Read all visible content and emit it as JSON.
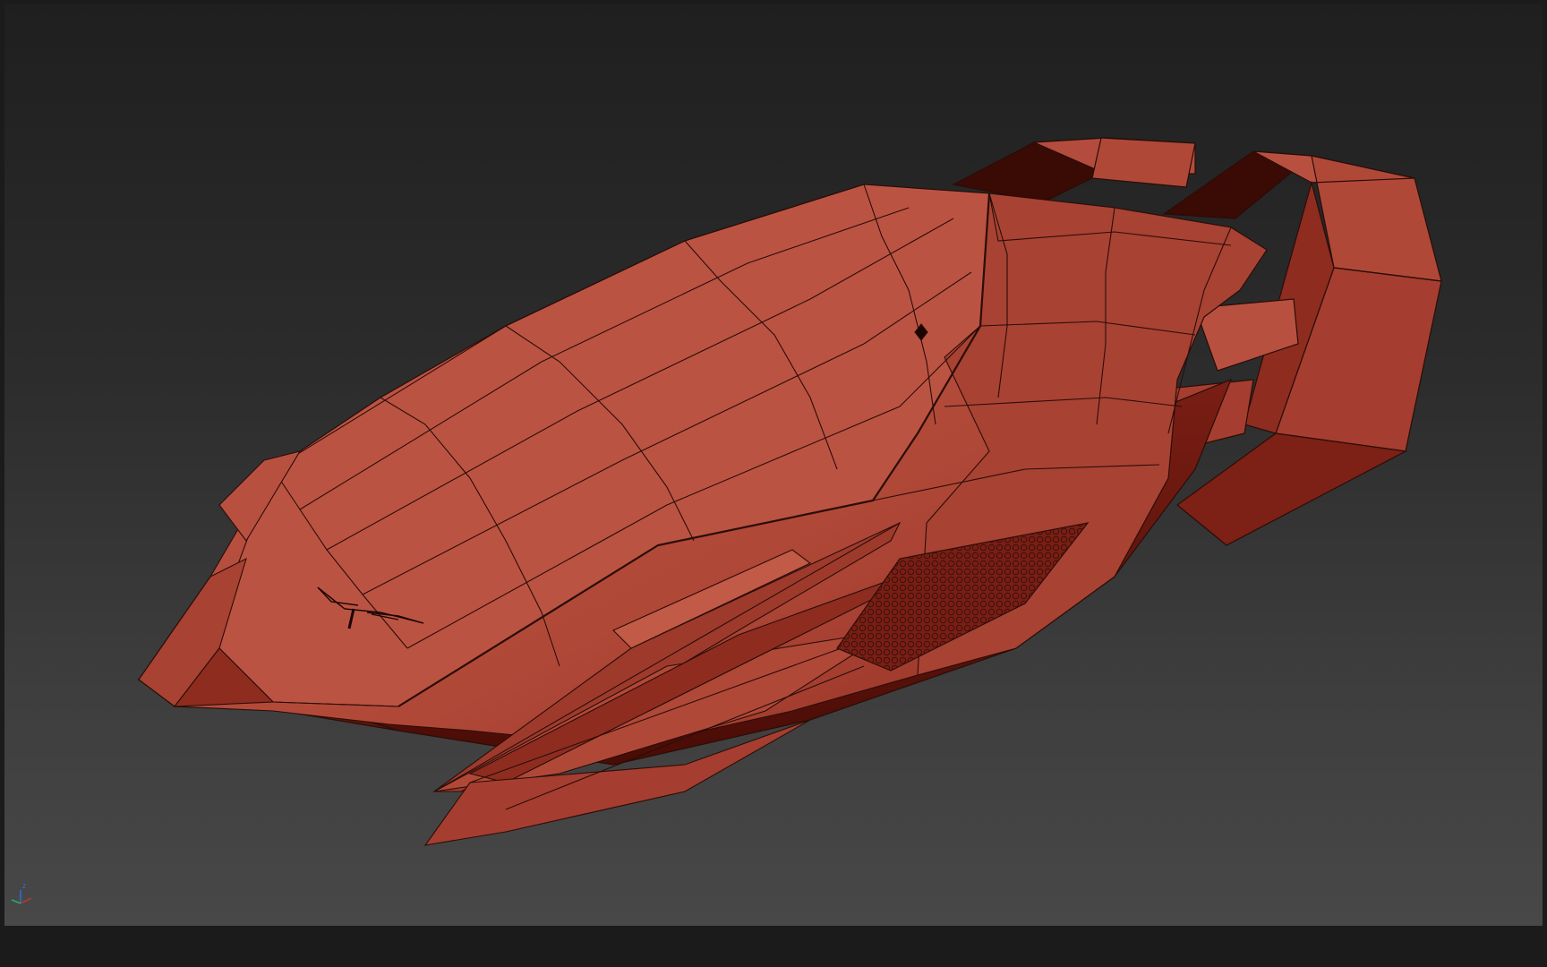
{
  "viewport": {
    "background_top": "#1f1f1f",
    "background_bottom": "#484848",
    "model_color": "#b44c3e",
    "wire_color": "#2a0d08"
  },
  "gizmo": {
    "axis_x_color": "#c0392b",
    "axis_y_color": "#27ae60",
    "axis_z_color": "#2f6fd6",
    "z_label": "z"
  },
  "model": {
    "name": "spaceship",
    "features": [
      "hull-wireframe",
      "logo-emblem",
      "hex-vent-grille",
      "rear-engine-ring"
    ]
  }
}
